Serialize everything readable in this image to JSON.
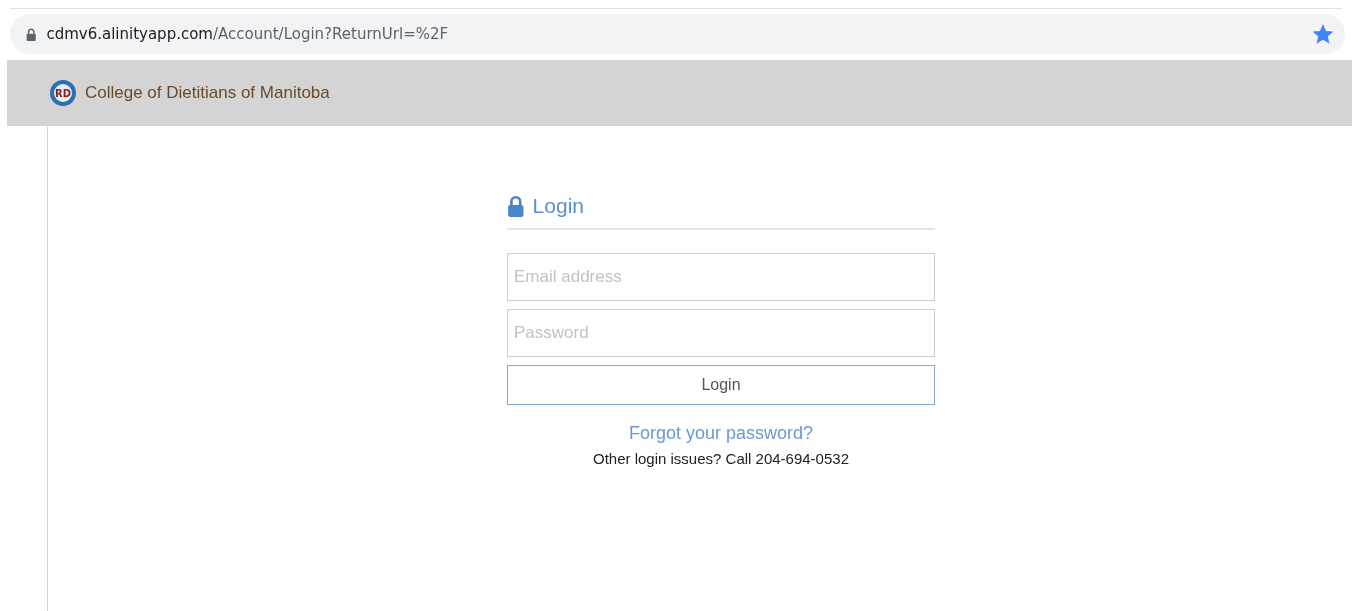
{
  "browser": {
    "url_domain": "cdmv6.alinityapp.com",
    "url_path": "/Account/Login?ReturnUrl=%2F",
    "bookmarked": true
  },
  "header": {
    "logo_text": "RD",
    "title": "College of Dietitians of Manitoba"
  },
  "login": {
    "heading": "Login",
    "email": {
      "placeholder": "Email address"
    },
    "password": {
      "placeholder": "Password"
    },
    "button": "Login",
    "forgot_link": "Forgot your password?",
    "help_text": "Other login issues? Call 204-694-0532"
  }
}
